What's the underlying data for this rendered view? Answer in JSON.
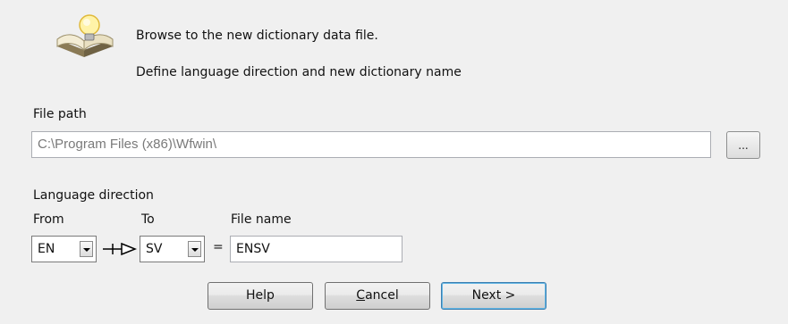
{
  "header": {
    "instruction_1": "Browse to the new dictionary data file.",
    "instruction_2": "Define language direction and new dictionary name",
    "icon": "book-lightbulb-icon"
  },
  "file_path": {
    "label": "File path",
    "value": "C:\\Program Files (x86)\\Wfwin\\",
    "browse_label": "..."
  },
  "language": {
    "section_label": "Language direction",
    "from_label": "From",
    "to_label": "To",
    "filename_label": "File name",
    "from_value": "EN",
    "to_value": "SV",
    "equals": "=",
    "filename_value": "ENSV"
  },
  "buttons": {
    "help": "Help",
    "cancel_prefix": "C",
    "cancel_rest": "ancel",
    "next": "Next >"
  }
}
